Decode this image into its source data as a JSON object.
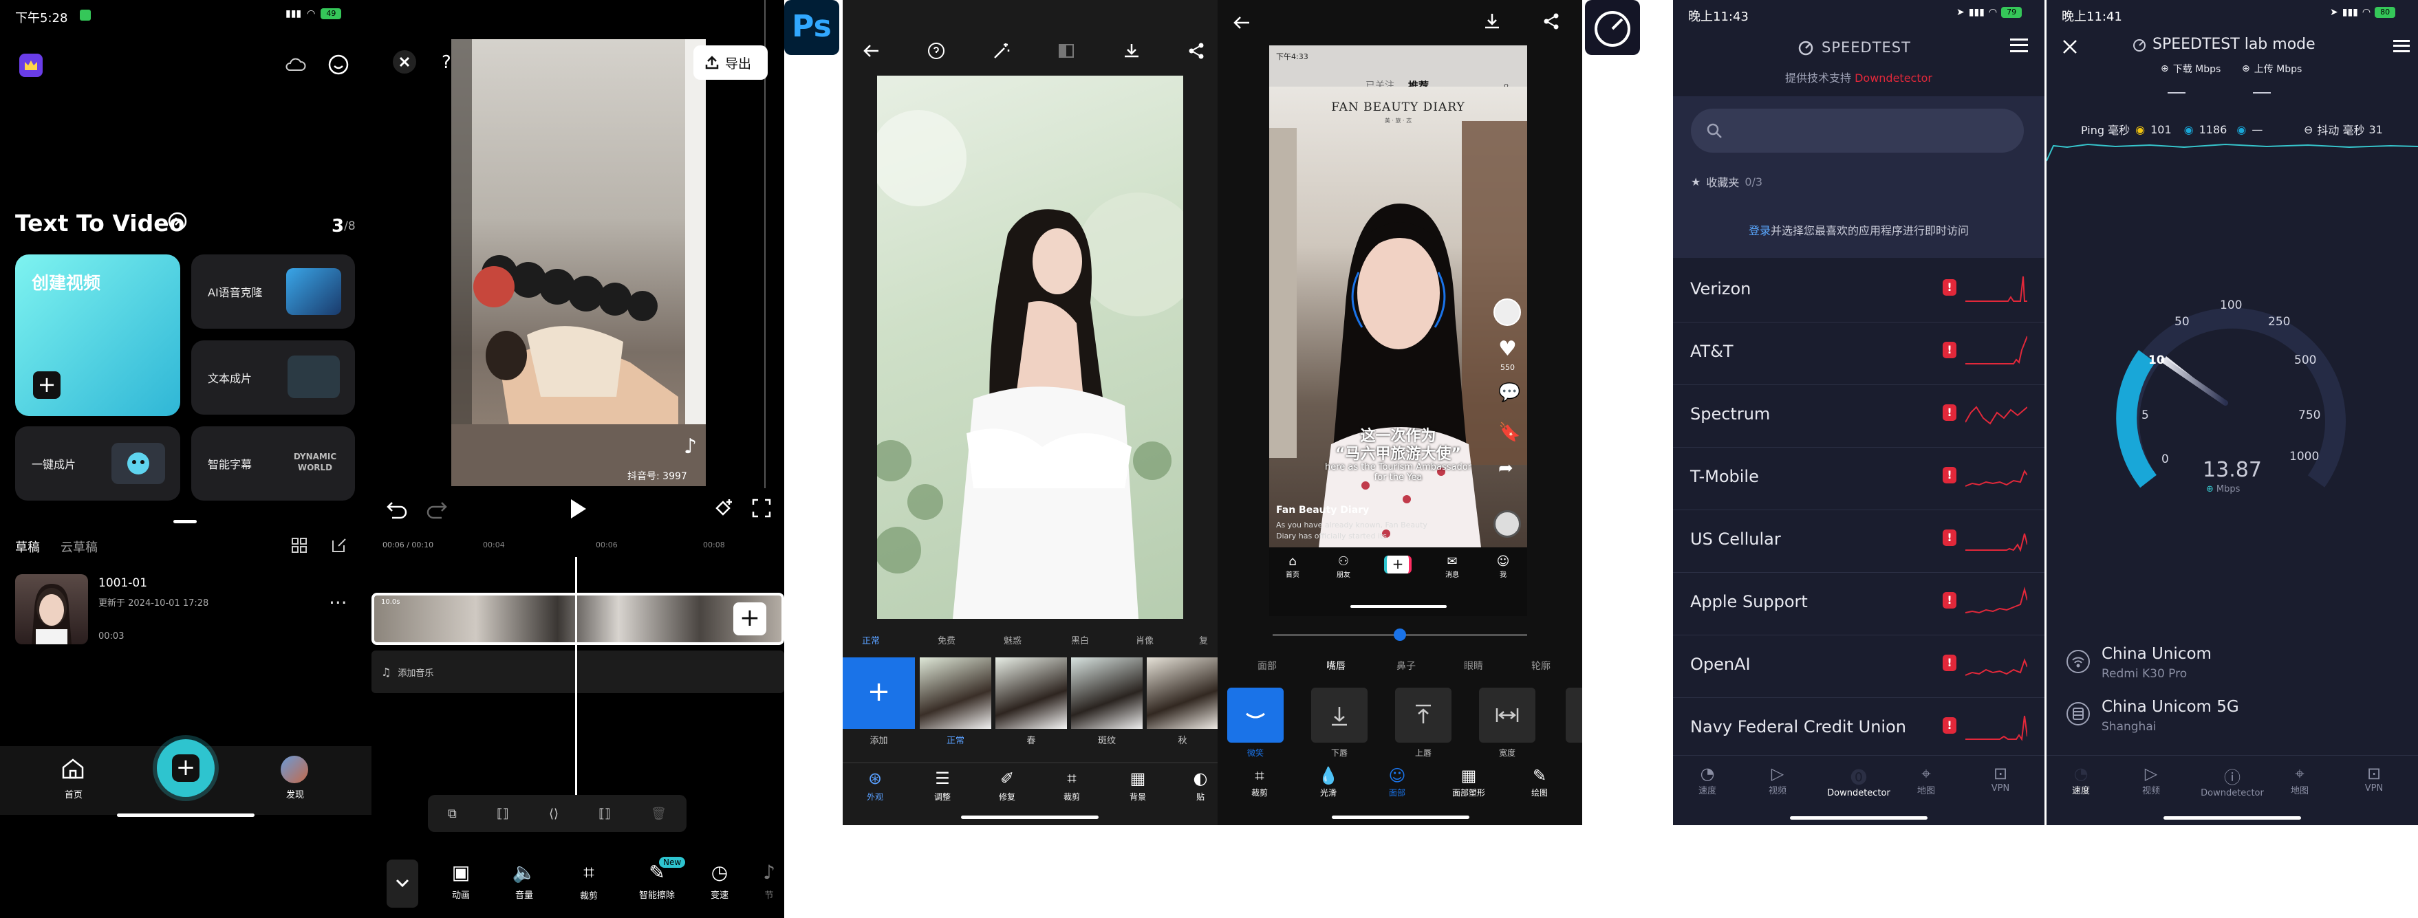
{
  "colors": {
    "teal": "#36c5cc",
    "blue": "#1a73e8",
    "red": "#e2283a",
    "ps_blue": "#001e36",
    "ps_text": "#31a8ff",
    "gauge": "#19a7d8",
    "navy": "#1a1d2e"
  },
  "p1": {
    "status": {
      "time": "下午5:28",
      "battery": "49"
    },
    "title": "Text To Video",
    "counter_cur": "3",
    "counter_total": "/8",
    "create_label": "创建视频",
    "tiles": [
      "AI语音克隆",
      "文本成片",
      "一键成片",
      "智能字幕"
    ],
    "tile_badge": "DYNAMIC WORLD",
    "tabs": [
      "草稿",
      "云草稿"
    ],
    "draft": {
      "name": "1001-01",
      "updated": "更新于 2024-10-01 17:28",
      "duration": "00:03"
    },
    "nav": {
      "home": "首页",
      "discover": "发现"
    },
    "icons": [
      "crown-icon",
      "cloud-icon",
      "smile-icon",
      "plus-icon",
      "grid-icon",
      "edit-icon",
      "more-icon",
      "home-icon"
    ]
  },
  "p2": {
    "export_label": "导出",
    "watermark": "抖音号: 3997",
    "times": [
      "00:06 / 00:10",
      "00:04",
      "00:06",
      "00:08"
    ],
    "add_music": "添加音乐",
    "tools": [
      "动画",
      "音量",
      "裁剪",
      "智能擦除",
      "变速",
      "节"
    ],
    "new_badge": "New",
    "icons": [
      "close-icon",
      "help-icon",
      "undo-icon",
      "redo-icon",
      "play-icon",
      "keyframe-icon",
      "fullscreen-icon",
      "copy-icon",
      "split-icon",
      "delete-icon",
      "chevron-down-icon"
    ]
  },
  "p3": {
    "logo": "Ps",
    "filters": [
      "正常",
      "免费",
      "魅惑",
      "黑白",
      "肖像",
      "复"
    ],
    "thumb_labels": [
      "添加",
      "正常",
      "春",
      "斑纹",
      "秋"
    ],
    "tools": [
      "外观",
      "调整",
      "修复",
      "裁剪",
      "背景",
      "贴"
    ],
    "icons": [
      "back-icon",
      "help-icon",
      "magic-icon",
      "compare-icon",
      "download-icon",
      "share-icon"
    ]
  },
  "p4": {
    "phone_time": "下午4:33",
    "tabs_top": [
      "已关注",
      "推荐"
    ],
    "banner": "FAN BEAUTY DIARY",
    "banner_sub": "美 · 旅 · 志",
    "caption_cn": "这一次作为",
    "caption_cn2": "“马六甲旅游大使”",
    "caption_en": "here as the Tourism Ambassador for the Yea",
    "account": "Fan Beauty Diary",
    "desc": "As you have already known, Fan Beauty Diary has officially started its",
    "likes": "550",
    "bottom_nav": [
      "首页",
      "朋友",
      "",
      "消息",
      "我"
    ],
    "face_tabs": [
      "面部",
      "嘴唇",
      "鼻子",
      "眼睛",
      "轮廓"
    ],
    "face_tools": [
      "微笑",
      "下唇",
      "上唇",
      "宽度"
    ],
    "bottom_tools": [
      "裁剪",
      "光滑",
      "面部",
      "面部塑形",
      "绘图"
    ],
    "icons": [
      "back-icon",
      "download-icon",
      "share-icon",
      "heart-icon",
      "comment-icon",
      "bookmark-icon",
      "forward-icon"
    ]
  },
  "p5": {
    "status": {
      "time": "晚上11:43",
      "battery": "79"
    },
    "brand": "SPEEDTEST",
    "powered": "提供技术支持 ",
    "powered_brand": "Downdetector",
    "fav_label": "收藏夹",
    "fav_count": "0/3",
    "login": "登录",
    "login_rest": "并选择您最喜欢的应用程序进行即时访问",
    "carriers": [
      "Verizon",
      "AT&T",
      "Spectrum",
      "T-Mobile",
      "US Cellular",
      "Apple Support",
      "OpenAI",
      "Navy Federal Credit Union"
    ],
    "nav": [
      "速度",
      "视频",
      "Downdetector",
      "地图",
      "VPN"
    ]
  },
  "p6": {
    "status": {
      "time": "晚上11:41",
      "battery": "80"
    },
    "title": "SPEEDTEST lab mode",
    "download": "下载 Mbps",
    "upload": "上传 Mbps",
    "ping_label": "Ping 毫秒",
    "ping_val": "101",
    "down_val": "1186",
    "up_val": "—",
    "jitter_label": "抖动 毫秒",
    "jitter_val": "31",
    "gauge_labels": [
      "0",
      "5",
      "10",
      "50",
      "100",
      "250",
      "500",
      "750",
      "1000"
    ],
    "speed": "13.87",
    "speed_unit": "Mbps",
    "provider": "China Unicom",
    "device": "Redmi K30 Pro",
    "server": "China Unicom 5G",
    "city": "Shanghai",
    "nav": [
      "速度",
      "视频",
      "Downdetector",
      "地图",
      "VPN"
    ]
  }
}
